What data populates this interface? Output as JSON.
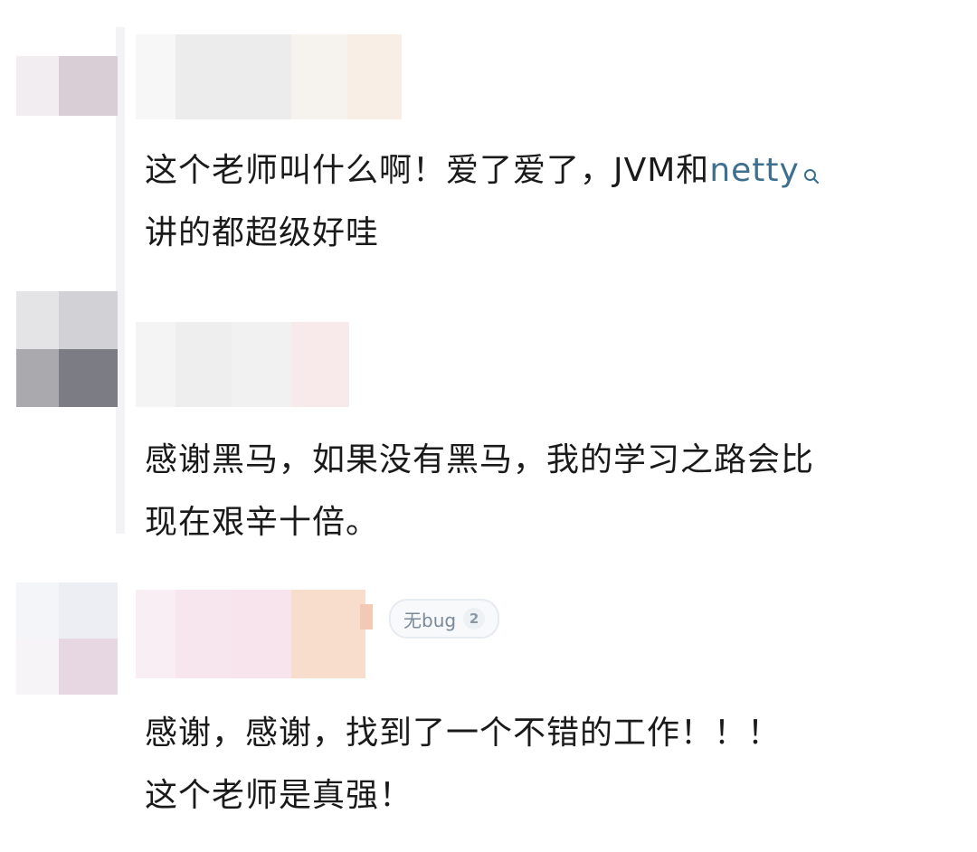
{
  "comments": [
    {
      "line1_before": "这个老师叫什么啊！爱了爱了，JVM和",
      "line1_link": "netty",
      "line2": "讲的都超级好哇",
      "icon": "search-icon"
    },
    {
      "line1": "感谢黑马，如果没有黑马，我的学习之路会比",
      "line2": "现在艰辛十倍。"
    },
    {
      "badge_label": "无bug",
      "badge_level": "2",
      "line1": "感谢，感谢，找到了一个不错的工作！！！",
      "line2": "这个老师是真强！"
    }
  ],
  "colors": {
    "link": "#3d6f8e",
    "text": "#1a1a1a",
    "badge_text": "#7b8a99"
  }
}
